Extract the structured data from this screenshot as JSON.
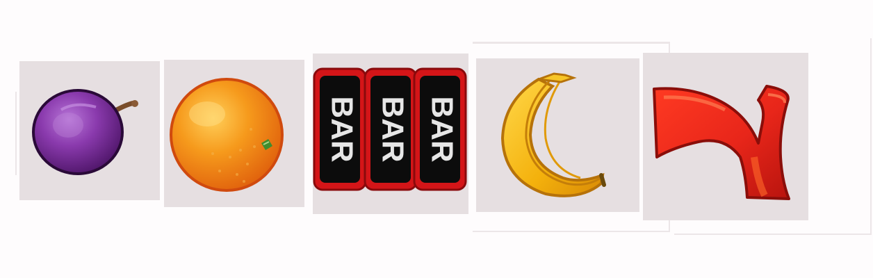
{
  "reel": {
    "symbols": [
      {
        "symbol": "plum",
        "icon": "plum-icon",
        "colors": {
          "body": "#7a2f9c",
          "highlight": "#b063cc",
          "stem": "#8a5a35"
        }
      },
      {
        "symbol": "orange",
        "icon": "orange-icon",
        "colors": {
          "body": "#f38a16",
          "rim": "#d85a10",
          "leaf": "#4fa03a"
        }
      },
      {
        "symbol": "triple-bar",
        "icon": "triple-bar-icon",
        "bar_label": "BAR",
        "colors": {
          "frame": "#d41518",
          "face": "#0c0c0c",
          "text": "#e6e6e6"
        }
      },
      {
        "symbol": "banana",
        "icon": "banana-icon",
        "colors": {
          "body": "#f5b90e",
          "edge": "#c47e0a",
          "tip": "#7a5a10"
        }
      },
      {
        "symbol": "seven",
        "icon": "seven-icon",
        "colors": {
          "body": "#e8261a",
          "shade": "#b8140e",
          "light": "#ff6a2a"
        }
      }
    ]
  }
}
